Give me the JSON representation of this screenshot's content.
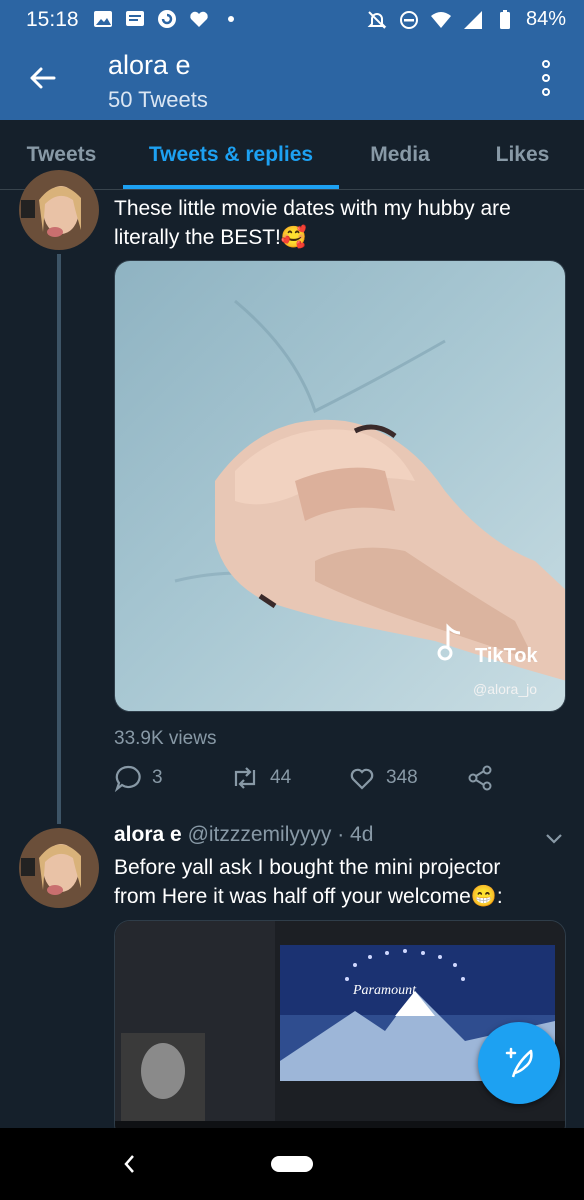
{
  "status_bar": {
    "time": "15:18",
    "battery": "84%",
    "left_icons": [
      "image-icon",
      "message-icon",
      "notification-icon",
      "heart-icon",
      "dot-icon"
    ],
    "right_icons": [
      "mute-icon",
      "dnd-icon",
      "wifi-icon",
      "signal-icon",
      "battery-icon"
    ]
  },
  "header": {
    "title": "alora e",
    "subtitle": "50 Tweets"
  },
  "tabs": [
    {
      "label": "Tweets",
      "active": false
    },
    {
      "label": "Tweets & replies",
      "active": true
    },
    {
      "label": "Media",
      "active": false
    },
    {
      "label": "Likes",
      "active": false
    }
  ],
  "tweet1": {
    "text_line1": "These little movie dates with my hubby are",
    "text_line2": "literally the BEST!🥰",
    "media_watermark": "TikTok",
    "media_handle": "@alora_jo",
    "views": "33.9K views",
    "replies": "3",
    "retweets": "44",
    "likes": "348"
  },
  "tweet2": {
    "name": "alora e",
    "handle": "@itzzzemilyyyy",
    "time": "· 4d",
    "text_line1": "Before yall ask I bought the mini projector",
    "text_line2": "from   Here it was half off your welcome😁:",
    "media_text": "Paramount"
  },
  "colors": {
    "header_bg": "#2c65a3",
    "bg": "#15202b",
    "accent": "#1da1f2",
    "muted": "#8899a6"
  }
}
